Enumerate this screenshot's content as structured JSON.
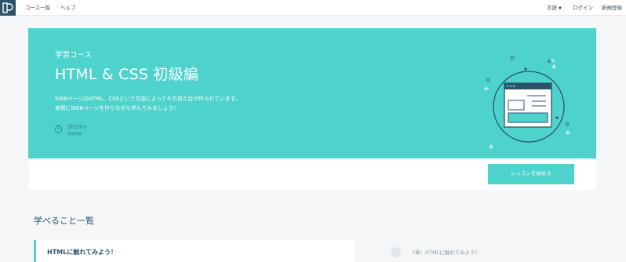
{
  "nav": {
    "logo": "progate-logo-icon",
    "course_list": "コース一覧",
    "help": "ヘルプ",
    "language": "言語",
    "login": "ログイン",
    "signup": "新規登録"
  },
  "hero": {
    "subtitle": "学習コース",
    "title": "HTML & CSS 初級編",
    "description_line1": "WEBページはHTML、CSSという言語によってその見た目が作られています。",
    "description_line2": "実際にWEBページを作りながら学んでみましょう！",
    "time": "3h50m",
    "time_label": "目安時間",
    "start_button": "レッスンを始める"
  },
  "learn": {
    "section_title": "学べること一覧",
    "card_title": "HTMLに触れてみよう！",
    "chapter_label": "1章：HTMLに触れてみよう！"
  },
  "colors": {
    "accent": "#4ed2cc",
    "navy": "#2b546a",
    "background": "#f4f6f8"
  }
}
